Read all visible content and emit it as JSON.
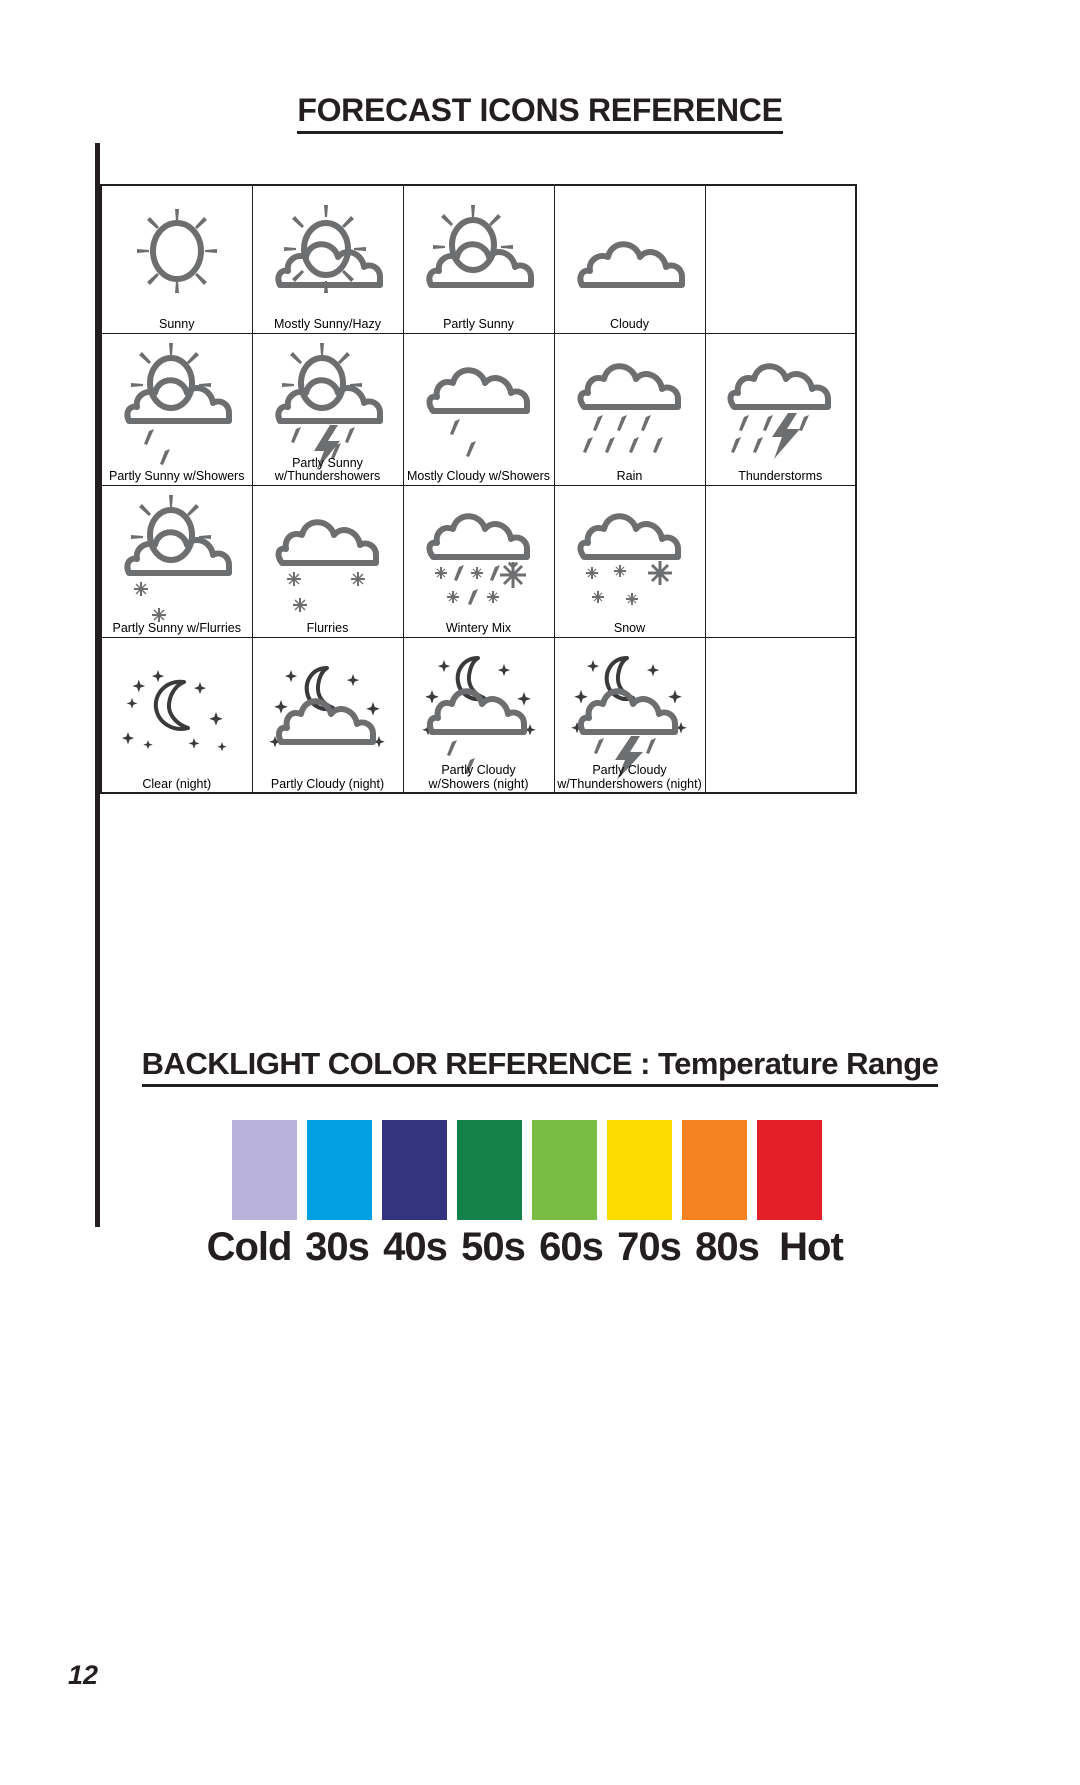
{
  "document": {
    "page_number": "12"
  },
  "forecast_section": {
    "heading": "FORECAST ICONS REFERENCE",
    "rows": [
      [
        {
          "label": "Sunny",
          "icon": "sunny-icon"
        },
        {
          "label": "Mostly Sunny/Hazy",
          "icon": "mostly-sunny-hazy-icon"
        },
        {
          "label": "Partly Sunny",
          "icon": "partly-sunny-icon"
        },
        {
          "label": "Cloudy",
          "icon": "cloudy-icon"
        },
        {
          "label": "",
          "icon": ""
        }
      ],
      [
        {
          "label": "Partly Sunny w/Showers",
          "icon": "partly-sunny-showers-icon"
        },
        {
          "label": "Partly Sunny\nw/Thundershowers",
          "icon": "partly-sunny-thundershowers-icon"
        },
        {
          "label": "Mostly Cloudy w/Showers",
          "icon": "mostly-cloudy-showers-icon"
        },
        {
          "label": "Rain",
          "icon": "rain-icon"
        },
        {
          "label": "Thunderstorms",
          "icon": "thunderstorms-icon"
        }
      ],
      [
        {
          "label": "Partly Sunny w/Flurries",
          "icon": "partly-sunny-flurries-icon"
        },
        {
          "label": "Flurries",
          "icon": "flurries-icon"
        },
        {
          "label": "Wintery Mix",
          "icon": "wintery-mix-icon"
        },
        {
          "label": "Snow",
          "icon": "snow-icon"
        },
        {
          "label": "",
          "icon": ""
        }
      ],
      [
        {
          "label": "Clear (night)",
          "icon": "clear-night-icon"
        },
        {
          "label": "Partly Cloudy (night)",
          "icon": "partly-cloudy-night-icon"
        },
        {
          "label": "Partly Cloudy\nw/Showers (night)",
          "icon": "partly-cloudy-showers-night-icon"
        },
        {
          "label": "Partly Cloudy\nw/Thundershowers (night)",
          "icon": "partly-cloudy-thundershowers-night-icon"
        },
        {
          "label": "",
          "icon": ""
        }
      ]
    ]
  },
  "backlight_section": {
    "heading": "BACKLIGHT COLOR REFERENCE : Temperature Range",
    "swatches": [
      {
        "label": "Cold",
        "color": "#b9b2dc"
      },
      {
        "label": "30s",
        "color": "#00a0e2"
      },
      {
        "label": "40s",
        "color": "#33337f"
      },
      {
        "label": "50s",
        "color": "#13824a"
      },
      {
        "label": "60s",
        "color": "#79bd45"
      },
      {
        "label": "70s",
        "color": "#fcdb00"
      },
      {
        "label": "80s",
        "color": "#f58220"
      },
      {
        "label": "Hot",
        "color": "#e41e26"
      }
    ]
  }
}
